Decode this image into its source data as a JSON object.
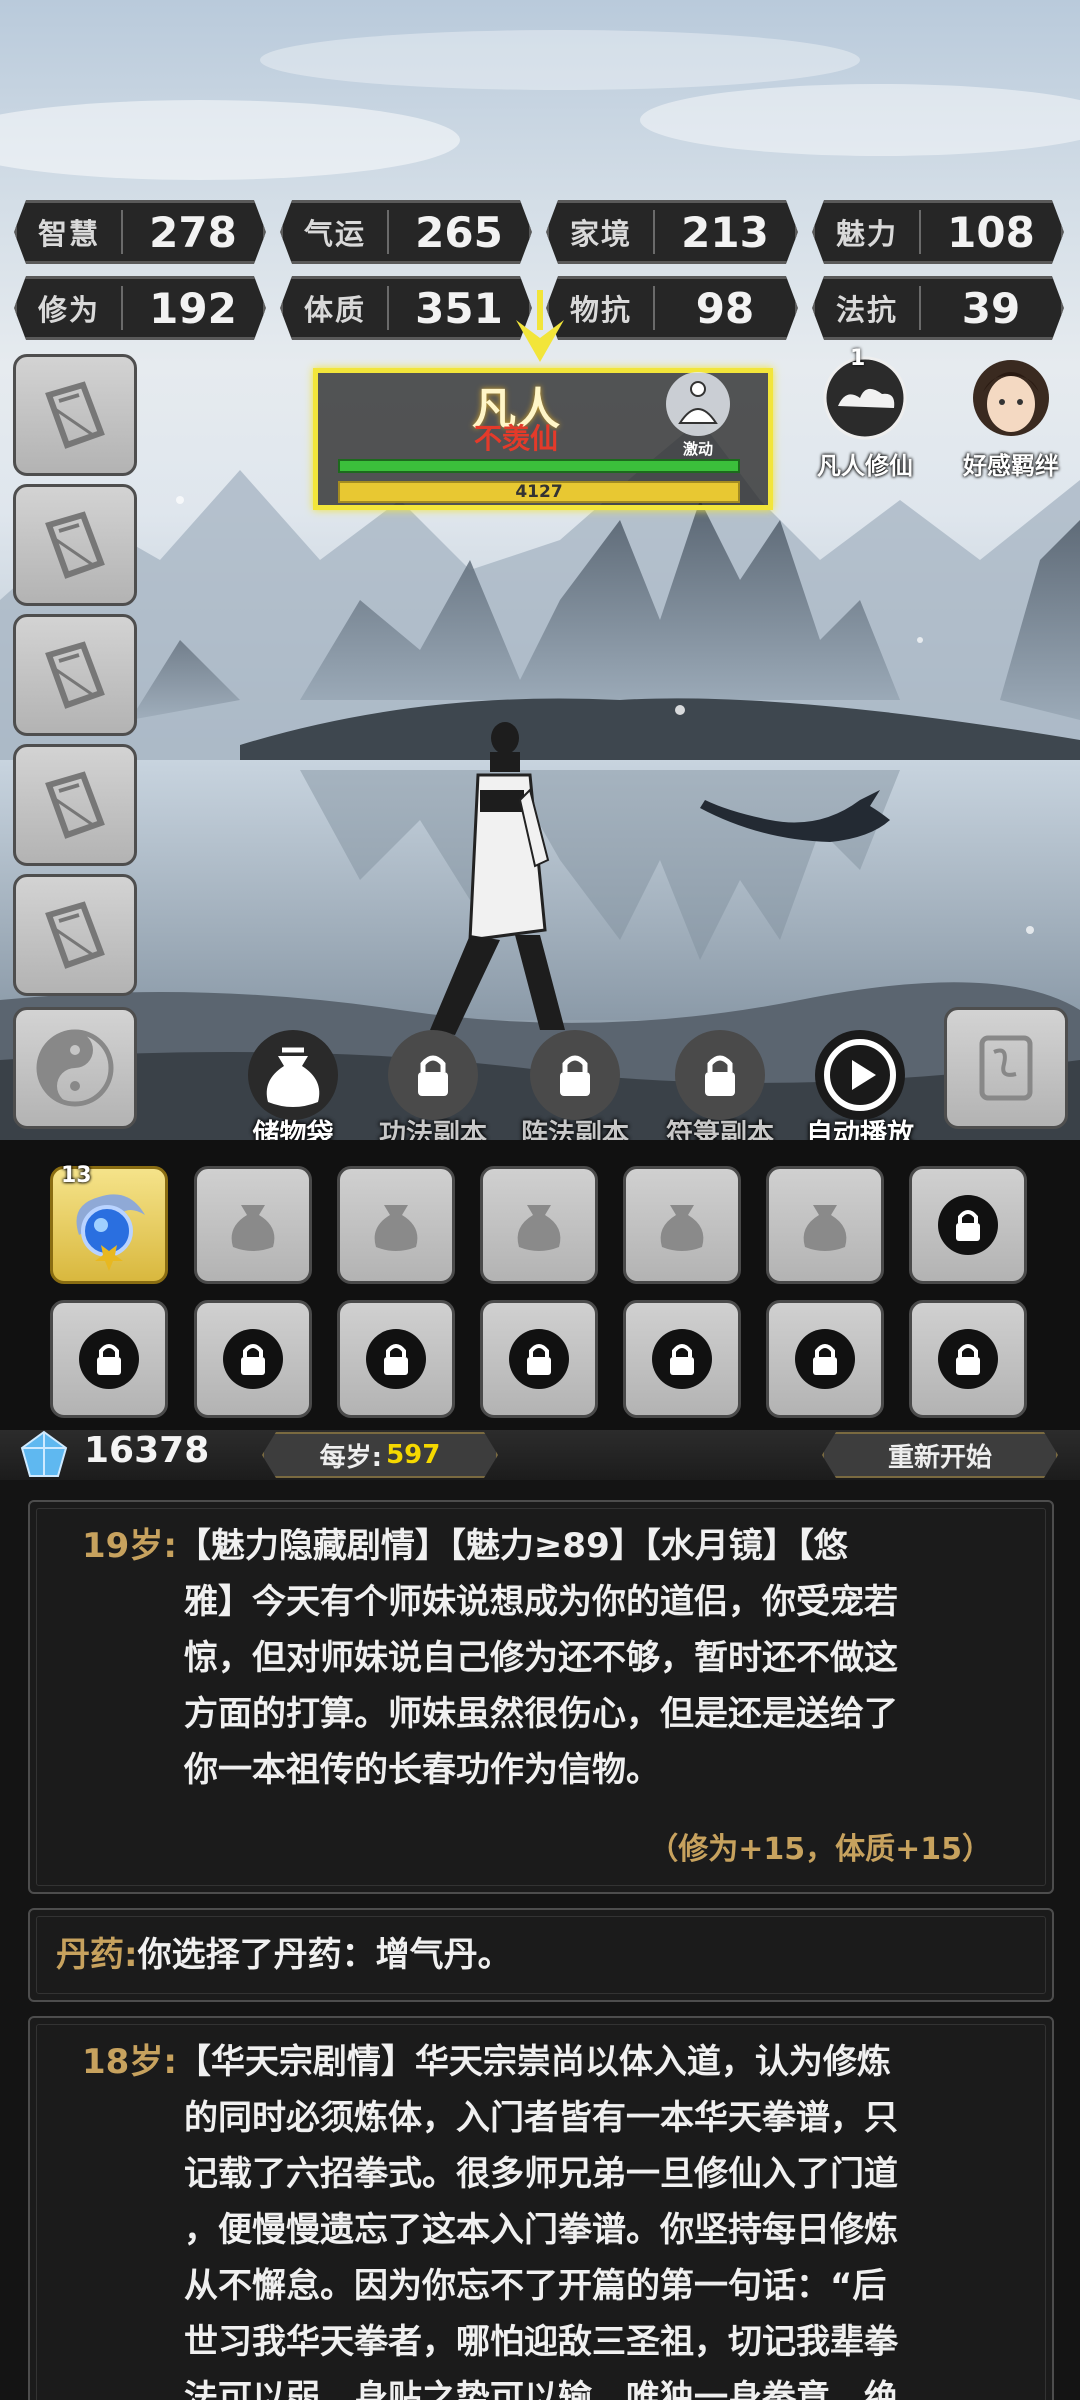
{
  "stats_row1": [
    {
      "label": "智慧",
      "value": "278"
    },
    {
      "label": "气运",
      "value": "265"
    },
    {
      "label": "家境",
      "value": "213"
    },
    {
      "label": "魅力",
      "value": "108"
    }
  ],
  "stats_row2": [
    {
      "label": "修为",
      "value": "192"
    },
    {
      "label": "体质",
      "value": "351"
    },
    {
      "label": "物抗",
      "value": "98"
    },
    {
      "label": "法抗",
      "value": "39"
    }
  ],
  "realm": {
    "name": "凡人",
    "subtitle": "不羡仙",
    "exp_value": "4127",
    "exp_fraction": 1.0,
    "meditate_label": "激动"
  },
  "top_icons": {
    "mortal_label": "凡人修仙",
    "mortal_badge": "1",
    "affection_label": "好感羁绊"
  },
  "actions": [
    {
      "label": "储物袋",
      "locked": false
    },
    {
      "label": "功法副本",
      "locked": true
    },
    {
      "label": "阵法副本",
      "locked": true
    },
    {
      "label": "符箓副本",
      "locked": true
    },
    {
      "label": "自动播放",
      "locked": false
    }
  ],
  "inventory": {
    "featured_count": "13"
  },
  "resources": {
    "gems": "16378",
    "per_age_label": "每岁:",
    "per_age_value": "597",
    "restart_label": "重新开始"
  },
  "log": {
    "entry1": {
      "age": "19岁:",
      "line1": "【魅力隐藏剧情】【魅力≥89】【水月镜】【悠",
      "line2": "雅】今天有个师妹说想成为你的道侣，你受宠若",
      "line3": "惊，但对师妹说自己修为还不够，暂时还不做这",
      "line4": "方面的打算。师妹虽然很伤心，但是还是送给了",
      "line5": "你一本祖传的长春功作为信物。",
      "note": "（修为+15，体质+15）"
    },
    "entry2": {
      "age": "丹药:",
      "text": "你选择了丹药：增气丹。"
    },
    "entry3": {
      "age": "18岁:",
      "line1": "【华天宗剧情】华天宗崇尚以体入道，认为修炼",
      "line2": "的同时必须炼体，入门者皆有一本华天拳谱，只",
      "line3": "记载了六招拳式。很多师兄弟一旦修仙入了门道",
      "line4": "，便慢慢遗忘了这本入门拳谱。你坚持每日修炼",
      "line5": "从不懈怠。因为你忘不了开篇的第一句话：“后",
      "line6": "世习我华天拳者，哪怕迎敌三圣祖，切记我辈拳",
      "line7": "法可以弱，身贴之势可以输，唯独一身拳意，绝"
    }
  },
  "colors": {
    "accent_yellow": "#f2e53a",
    "gold_text": "#c7a25e",
    "per_age_gold": "#f5d800",
    "realm_red": "#e43a2a"
  }
}
